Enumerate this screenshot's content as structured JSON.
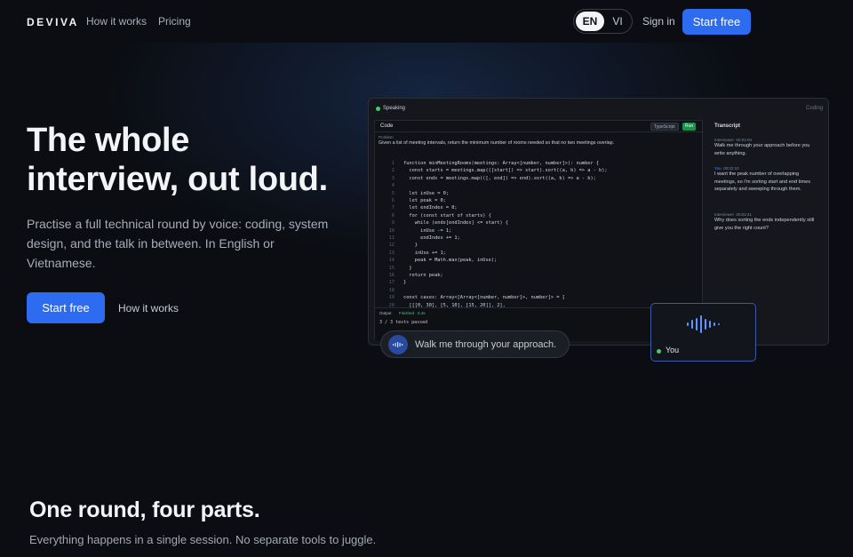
{
  "nav": {
    "logo": "DEVIVA",
    "links": [
      "How it works",
      "Pricing"
    ],
    "lang_en": "EN",
    "lang_vi": "VI",
    "signin": "Sign in",
    "cta": "Start free"
  },
  "hero": {
    "title_line1": "The whole",
    "title_line2": "interview, out loud.",
    "subtitle": "Practise a full technical round by voice: coding, system design, and the talk in between. In English or Vietnamese.",
    "cta": "Start free",
    "secondary": "How it works"
  },
  "mock": {
    "status": "Speaking",
    "mode": "Coding",
    "code_label": "Code",
    "lang_badge": "TypeScript",
    "run_badge": "Run",
    "problem_label": "Problem",
    "problem_text": "Given a list of meeting intervals, return the minimum number of rooms needed so that no two meetings overlap.",
    "code_lines": [
      "function minMeetingRooms(meetings: Array<[number, number]>): number {",
      "  const starts = meetings.map(([start]) => start).sort((a, b) => a - b);",
      "  const ends = meetings.map(([, end]) => end).sort((a, b) => a - b);",
      "",
      "  let inUse = 0;",
      "  let peak = 0;",
      "  let endIndex = 0;",
      "  for (const start of starts) {",
      "    while (ends[endIndex] <= start) {",
      "      inUse -= 1;",
      "      endIndex += 1;",
      "    }",
      "    inUse += 1;",
      "    peak = Math.max(peak, inUse);",
      "  }",
      "  return peak;",
      "}",
      "",
      "const cases: Array<[Array<[number, number]>, number]> = [",
      "  [[[0, 30], [5, 10], [15, 20]], 2],"
    ],
    "output_label": "Output",
    "output_status": "Finished · 0.4s",
    "output_result": "3 / 3 tests passed",
    "transcript_label": "Transcript",
    "transcript": [
      {
        "who": "Interviewer",
        "time": "00:02:04",
        "text": "Walk me through your approach before you write anything."
      },
      {
        "who": "You",
        "time": "00:02:10",
        "text": "I want the peak number of overlapping meetings, so I'm sorting start and end times separately and sweeping through them."
      },
      {
        "who": "Interviewer",
        "time": "00:02:41",
        "text": "Why does sorting the ends independently still give you the right count?"
      }
    ]
  },
  "speech_bubble": "Walk me through your approach.",
  "you_card": "You",
  "section": {
    "title": "One round, four parts.",
    "subtitle": "Everything happens in a single session. No separate tools to juggle."
  },
  "colors": {
    "accent": "#2d6bf0",
    "background": "#0b0d12",
    "live": "#3ecf73"
  }
}
